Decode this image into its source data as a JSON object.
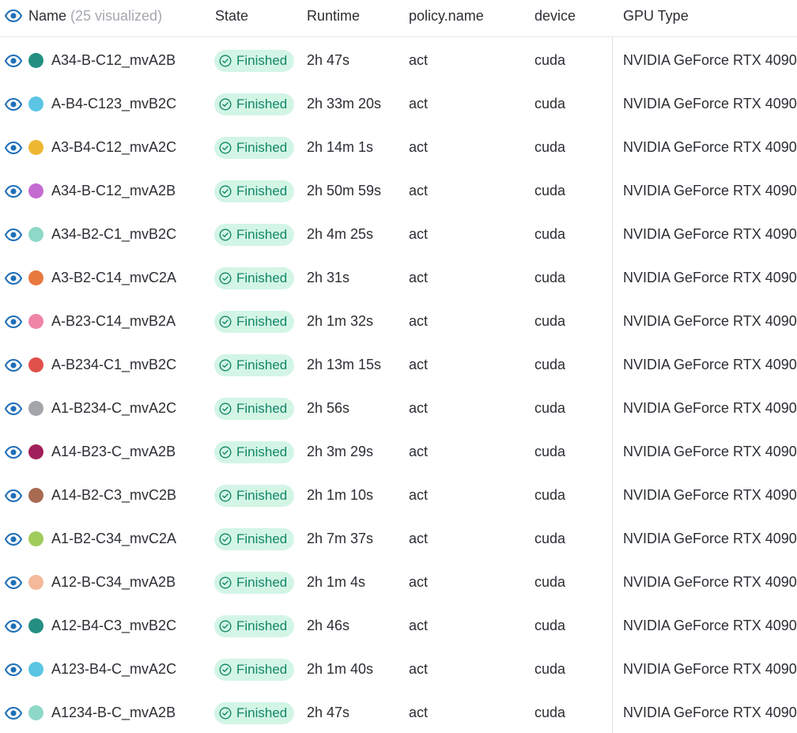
{
  "header": {
    "name_label": "Name",
    "visualized_note": "(25 visualized)",
    "state_label": "State",
    "runtime_label": "Runtime",
    "policy_label": "policy.name",
    "device_label": "device",
    "gpu_label": "GPU Type"
  },
  "rows": [
    {
      "name": "A34-B-C12_mvA2B",
      "color": "#238f82",
      "state": "Finished",
      "runtime": "2h 47s",
      "policy": "act",
      "device": "cuda",
      "gpu": "NVIDIA GeForce RTX 4090"
    },
    {
      "name": "A-B4-C123_mvB2C",
      "color": "#5bc5e3",
      "state": "Finished",
      "runtime": "2h 33m 20s",
      "policy": "act",
      "device": "cuda",
      "gpu": "NVIDIA GeForce RTX 4090"
    },
    {
      "name": "A3-B4-C12_mvA2C",
      "color": "#eeb731",
      "state": "Finished",
      "runtime": "2h 14m 1s",
      "policy": "act",
      "device": "cuda",
      "gpu": "NVIDIA GeForce RTX 4090"
    },
    {
      "name": "A34-B-C12_mvA2B",
      "color": "#c46ad0",
      "state": "Finished",
      "runtime": "2h 50m 59s",
      "policy": "act",
      "device": "cuda",
      "gpu": "NVIDIA GeForce RTX 4090"
    },
    {
      "name": "A34-B2-C1_mvB2C",
      "color": "#8ed8c7",
      "state": "Finished",
      "runtime": "2h 4m 25s",
      "policy": "act",
      "device": "cuda",
      "gpu": "NVIDIA GeForce RTX 4090"
    },
    {
      "name": "A3-B2-C14_mvC2A",
      "color": "#e8793f",
      "state": "Finished",
      "runtime": "2h 31s",
      "policy": "act",
      "device": "cuda",
      "gpu": "NVIDIA GeForce RTX 4090"
    },
    {
      "name": "A-B23-C14_mvB2A",
      "color": "#ef84a6",
      "state": "Finished",
      "runtime": "2h 1m 32s",
      "policy": "act",
      "device": "cuda",
      "gpu": "NVIDIA GeForce RTX 4090"
    },
    {
      "name": "A-B234-C1_mvB2C",
      "color": "#e0504a",
      "state": "Finished",
      "runtime": "2h 13m 15s",
      "policy": "act",
      "device": "cuda",
      "gpu": "NVIDIA GeForce RTX 4090"
    },
    {
      "name": "A1-B234-C_mvA2C",
      "color": "#a2a6aa",
      "state": "Finished",
      "runtime": "2h 56s",
      "policy": "act",
      "device": "cuda",
      "gpu": "NVIDIA GeForce RTX 4090"
    },
    {
      "name": "A14-B23-C_mvA2B",
      "color": "#a11f5c",
      "state": "Finished",
      "runtime": "2h 3m 29s",
      "policy": "act",
      "device": "cuda",
      "gpu": "NVIDIA GeForce RTX 4090"
    },
    {
      "name": "A14-B2-C3_mvC2B",
      "color": "#a86a51",
      "state": "Finished",
      "runtime": "2h 1m 10s",
      "policy": "act",
      "device": "cuda",
      "gpu": "NVIDIA GeForce RTX 4090"
    },
    {
      "name": "A1-B2-C34_mvC2A",
      "color": "#a0cc5c",
      "state": "Finished",
      "runtime": "2h 7m 37s",
      "policy": "act",
      "device": "cuda",
      "gpu": "NVIDIA GeForce RTX 4090"
    },
    {
      "name": "A12-B-C34_mvA2B",
      "color": "#f4b99b",
      "state": "Finished",
      "runtime": "2h 1m 4s",
      "policy": "act",
      "device": "cuda",
      "gpu": "NVIDIA GeForce RTX 4090"
    },
    {
      "name": "A12-B4-C3_mvB2C",
      "color": "#238f82",
      "state": "Finished",
      "runtime": "2h 46s",
      "policy": "act",
      "device": "cuda",
      "gpu": "NVIDIA GeForce RTX 4090"
    },
    {
      "name": "A123-B4-C_mvA2C",
      "color": "#5bc5e3",
      "state": "Finished",
      "runtime": "2h 1m 40s",
      "policy": "act",
      "device": "cuda",
      "gpu": "NVIDIA GeForce RTX 4090"
    },
    {
      "name": "A1234-B-C_mvA2B",
      "color": "#8ed8c7",
      "state": "Finished",
      "runtime": "2h 47s",
      "policy": "act",
      "device": "cuda",
      "gpu": "NVIDIA GeForce RTX 4090"
    }
  ],
  "colors": {
    "eye_icon": "#1f6fb8",
    "badge_bg": "#d3f5e6",
    "badge_text": "#128766"
  },
  "icons": {
    "visibility": "eye-icon",
    "status": "check-circle-icon"
  }
}
